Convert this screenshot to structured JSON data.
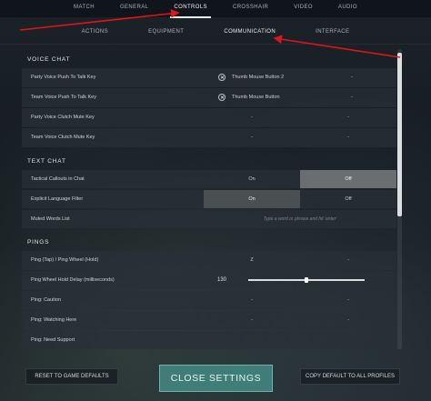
{
  "top_tabs": [
    {
      "label": "MATCH"
    },
    {
      "label": "GENERAL"
    },
    {
      "label": "CONTROLS",
      "active": true
    },
    {
      "label": "CROSSHAIR"
    },
    {
      "label": "VIDEO"
    },
    {
      "label": "AUDIO"
    }
  ],
  "sub_tabs": [
    {
      "label": "ACTIONS"
    },
    {
      "label": "EQUIPMENT"
    },
    {
      "label": "COMMUNICATION",
      "active": true
    },
    {
      "label": "INTERFACE"
    }
  ],
  "voice_chat": {
    "title": "VOICE CHAT",
    "rows": [
      {
        "label": "Party Voice Push To Talk Key",
        "primary": "Thumb Mouse Button 2",
        "secondary": "-"
      },
      {
        "label": "Team Voice Push To Talk Key",
        "primary": "Thumb Mouse Button",
        "secondary": "-"
      },
      {
        "label": "Party Voice Clutch Mute Key",
        "primary": "-",
        "secondary": "-"
      },
      {
        "label": "Team Voice Clutch Mute Key",
        "primary": "-",
        "secondary": "-"
      }
    ]
  },
  "text_chat": {
    "title": "TEXT CHAT",
    "tactical_label": "Tactical Callouts in Chat",
    "tactical_on": "On",
    "tactical_off": "Off",
    "explicit_label": "Explicit Language Filter",
    "explicit_on": "On",
    "explicit_off": "Off",
    "muted_label": "Muted Words List",
    "muted_placeholder": "Type a word or phrase and hit 'enter'"
  },
  "pings": {
    "title": "PINGS",
    "ping_wheel_label": "Ping (Tap) / Ping Wheel (Hold)",
    "ping_wheel_primary": "Z",
    "ping_wheel_secondary": "-",
    "delay_label": "Ping Wheel Hold Delay (milliseconds)",
    "delay_value": "130",
    "delay_fraction": 0.5,
    "caution_label": "Ping: Caution",
    "caution_primary": "-",
    "caution_secondary": "-",
    "watching_label": "Ping: Watching Here",
    "watching_primary": "-",
    "watching_secondary": "-",
    "need_support_label": "Ping: Need Support"
  },
  "footer": {
    "reset_label": "RESET TO GAME DEFAULTS",
    "close_label": "CLOSE SETTINGS",
    "copy_label": "COPY DEFAULT TO ALL PROFILES"
  },
  "colors": {
    "annotation_arrow": "#e0151b",
    "close_button": "#3e7d78"
  }
}
